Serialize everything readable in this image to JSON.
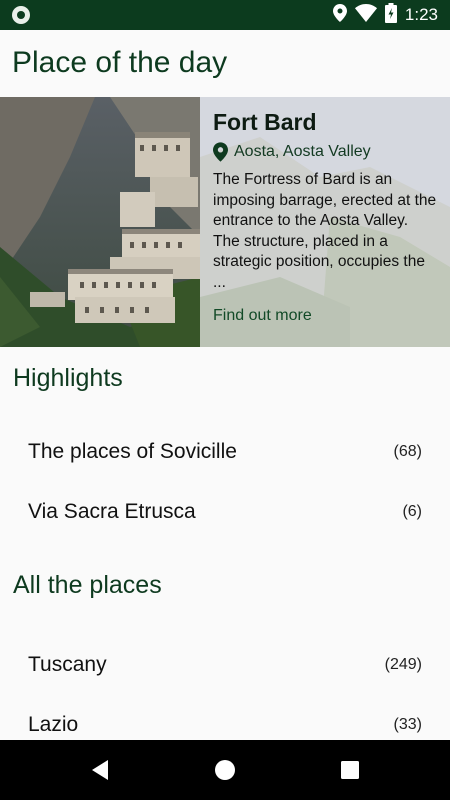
{
  "status_bar": {
    "time": "1:23",
    "icons": [
      "location-icon",
      "wifi-icon",
      "battery-charging-icon"
    ]
  },
  "app": {
    "title": "Place of the day"
  },
  "featured": {
    "title": "Fort Bard",
    "location": "Aosta, Aosta Valley",
    "description": "The Fortress of Bard is an imposing barrage, erected at the entrance to the Aosta Valley. The structure, placed in a strategic position, occupies the ...",
    "link": "Find out more"
  },
  "highlights": {
    "title": "Highlights",
    "items": [
      {
        "label": "The places of Sovicille",
        "count": "(68)"
      },
      {
        "label": "Via Sacra Etrusca",
        "count": "(6)"
      }
    ]
  },
  "all_places": {
    "title": "All the places",
    "items": [
      {
        "label": "Tuscany",
        "count": "(249)"
      },
      {
        "label": "Lazio",
        "count": "(33)"
      }
    ]
  },
  "navigation": [
    "back-icon",
    "home-icon",
    "recents-icon"
  ],
  "colors": {
    "status_bar": "#0c3b1e",
    "accent_text": "#0d3a1f",
    "background": "#fafafa",
    "nav_bar": "#000000"
  }
}
